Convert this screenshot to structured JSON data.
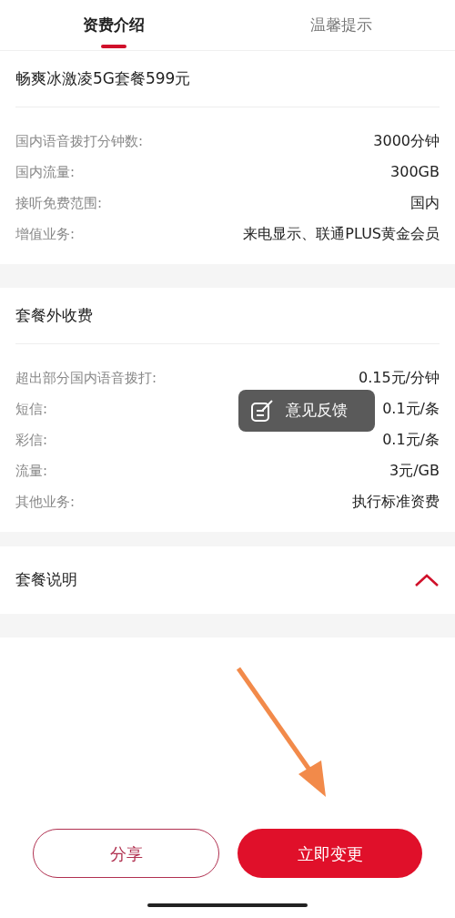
{
  "tabs": [
    {
      "label": "资费介绍",
      "selected": true
    },
    {
      "label": "温馨提示",
      "selected": false
    }
  ],
  "sections": [
    {
      "title": "畅爽冰激凌5G套餐599元",
      "rows": [
        {
          "label": "国内语音拨打分钟数:",
          "value": "3000分钟"
        },
        {
          "label": "国内流量:",
          "value": "300GB"
        },
        {
          "label": "接听免费范围:",
          "value": "国内"
        },
        {
          "label": "增值业务:",
          "value": "来电显示、联通PLUS黄金会员"
        }
      ]
    },
    {
      "title": "套餐外收费",
      "rows": [
        {
          "label": "超出部分国内语音拨打:",
          "value": "0.15元/分钟"
        },
        {
          "label": "短信:",
          "value": "0.1元/条"
        },
        {
          "label": "彩信:",
          "value": "0.1元/条"
        },
        {
          "label": "流量:",
          "value": "3元/GB"
        },
        {
          "label": "其他业务:",
          "value": "执行标准资费"
        }
      ]
    }
  ],
  "description": {
    "title": "套餐说明",
    "expanded": true
  },
  "feedback": {
    "label": "意见反馈"
  },
  "buttons": [
    {
      "label": "分享",
      "kind": "outline"
    },
    {
      "label": "立即变更",
      "kind": "primary"
    }
  ]
}
